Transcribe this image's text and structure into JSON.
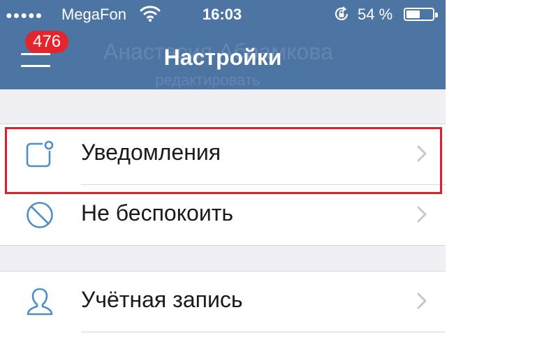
{
  "status_bar": {
    "signal": "●●●●●",
    "carrier": "MegaFon",
    "time": "16:03",
    "battery_percent_text": "54 %",
    "battery_level": 0.54
  },
  "header": {
    "title": "Настройки",
    "menu_badge": "476",
    "ghost_name": "Анастасия Абрамкова",
    "ghost_subtitle": "редактировать",
    "background_color": "#4c75a3",
    "badge_color": "#e3262e"
  },
  "settings": {
    "notifications": {
      "label": "Уведомления",
      "icon": "notifications-icon"
    },
    "do_not_disturb": {
      "label": "Не беспокоить",
      "icon": "do-not-disturb-icon"
    },
    "account": {
      "label": "Учётная запись",
      "icon": "account-icon"
    }
  },
  "colors": {
    "accent": "#4c8fc7",
    "highlight": "#e01e2c",
    "group_gap": "#efeff4"
  }
}
